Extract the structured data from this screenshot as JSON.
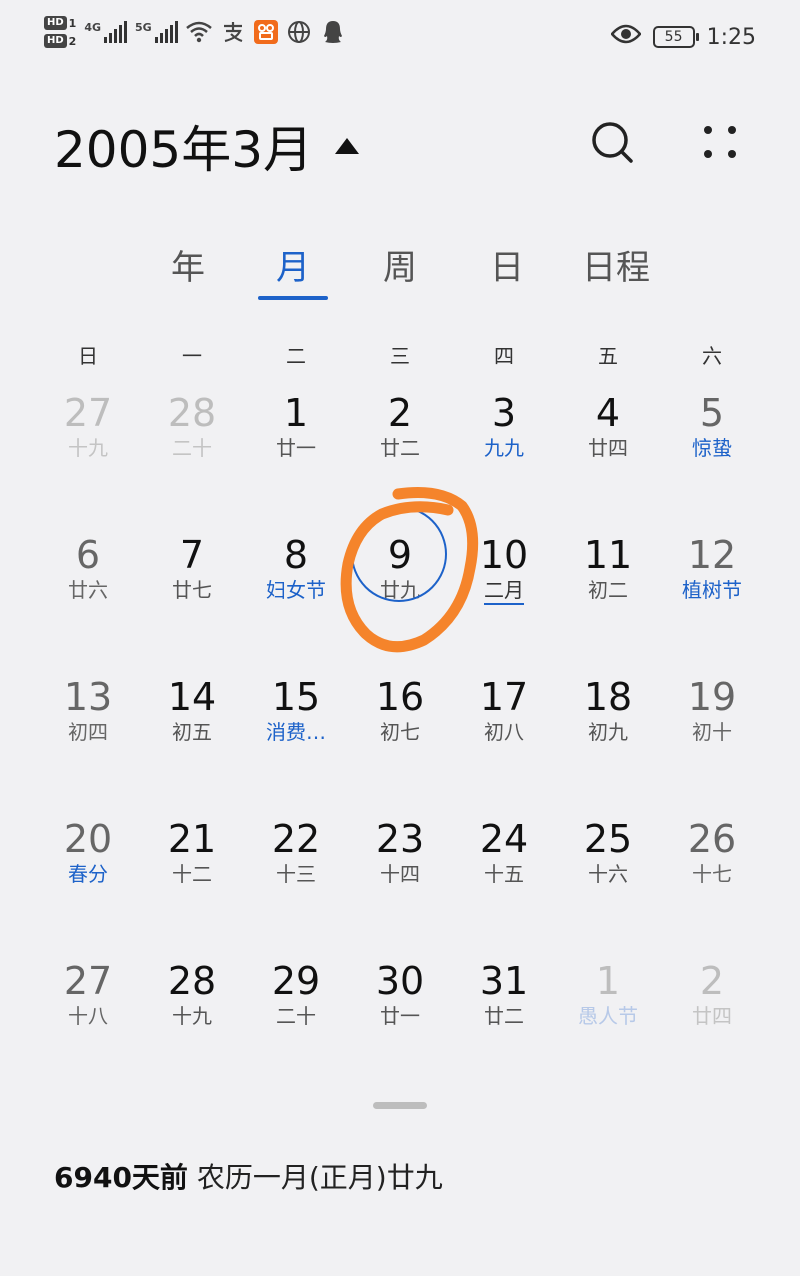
{
  "status_bar": {
    "hd1": "HD",
    "hd1_slot": "1",
    "hd2": "HD",
    "hd2_slot": "2",
    "net1": "4G",
    "net2": "5G",
    "icons": [
      "wifi-icon",
      "alipay-icon",
      "app-icon",
      "globe-icon",
      "qq-icon"
    ],
    "battery": "55",
    "time": "1:25"
  },
  "header": {
    "title": "2005年3月"
  },
  "tabs": [
    {
      "label": "年"
    },
    {
      "label": "月"
    },
    {
      "label": "周"
    },
    {
      "label": "日"
    },
    {
      "label": "日程"
    }
  ],
  "weekdays": [
    "日",
    "一",
    "二",
    "三",
    "四",
    "五",
    "六"
  ],
  "weeks": [
    [
      {
        "day": "27",
        "sub": "十九",
        "other": true
      },
      {
        "day": "28",
        "sub": "二十",
        "other": true
      },
      {
        "day": "1",
        "sub": "廿一"
      },
      {
        "day": "2",
        "sub": "廿二"
      },
      {
        "day": "3",
        "sub": "九九",
        "fest": true
      },
      {
        "day": "4",
        "sub": "廿四"
      },
      {
        "day": "5",
        "sub": "惊蛰",
        "fest": true
      }
    ],
    [
      {
        "day": "6",
        "sub": "廿六"
      },
      {
        "day": "7",
        "sub": "廿七"
      },
      {
        "day": "8",
        "sub": "妇女节",
        "fest": true
      },
      {
        "day": "9",
        "sub": "廿九",
        "selected": true
      },
      {
        "day": "10",
        "sub": "二月",
        "today": true
      },
      {
        "day": "11",
        "sub": "初二"
      },
      {
        "day": "12",
        "sub": "植树节",
        "fest": true
      }
    ],
    [
      {
        "day": "13",
        "sub": "初四"
      },
      {
        "day": "14",
        "sub": "初五"
      },
      {
        "day": "15",
        "sub": "消费…",
        "fest": true
      },
      {
        "day": "16",
        "sub": "初七"
      },
      {
        "day": "17",
        "sub": "初八"
      },
      {
        "day": "18",
        "sub": "初九"
      },
      {
        "day": "19",
        "sub": "初十"
      }
    ],
    [
      {
        "day": "20",
        "sub": "春分",
        "fest": true
      },
      {
        "day": "21",
        "sub": "十二"
      },
      {
        "day": "22",
        "sub": "十三"
      },
      {
        "day": "23",
        "sub": "十四"
      },
      {
        "day": "24",
        "sub": "十五"
      },
      {
        "day": "25",
        "sub": "十六"
      },
      {
        "day": "26",
        "sub": "十七"
      }
    ],
    [
      {
        "day": "27",
        "sub": "十八"
      },
      {
        "day": "28",
        "sub": "十九"
      },
      {
        "day": "29",
        "sub": "二十"
      },
      {
        "day": "30",
        "sub": "廿一"
      },
      {
        "day": "31",
        "sub": "廿二"
      },
      {
        "day": "1",
        "sub": "愚人节",
        "other": true,
        "fest": true
      },
      {
        "day": "2",
        "sub": "廿四",
        "other": true
      }
    ]
  ],
  "footer": {
    "days_ago": "6940天前",
    "lunar": "农历一月(正月)廿九"
  },
  "colors": {
    "accent": "#1d62c9",
    "annotation": "#f5842b",
    "background": "#f1f1f3"
  }
}
